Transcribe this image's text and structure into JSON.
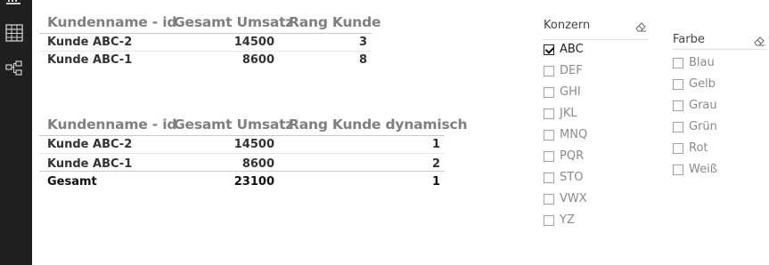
{
  "table1": {
    "headers": [
      "Kundenname - id",
      "Gesamt Umsatz",
      "Rang Kunde"
    ],
    "rows": [
      {
        "name": "Kunde ABC-2",
        "umsatz": "14500",
        "rang": "3"
      },
      {
        "name": "Kunde ABC-1",
        "umsatz": "8600",
        "rang": "8"
      }
    ]
  },
  "table2": {
    "headers": [
      "Kundenname - id",
      "Gesamt Umsatz",
      "Rang Kunde dynamisch"
    ],
    "rows": [
      {
        "name": "Kunde ABC-2",
        "umsatz": "14500",
        "rang": "1"
      },
      {
        "name": "Kunde ABC-1",
        "umsatz": "8600",
        "rang": "2"
      }
    ],
    "total": {
      "name": "Gesamt",
      "umsatz": "23100",
      "rang": "1"
    }
  },
  "slicer_konzern": {
    "title": "Konzern",
    "items": [
      {
        "label": "ABC",
        "checked": true
      },
      {
        "label": "DEF",
        "checked": false
      },
      {
        "label": "GHI",
        "checked": false
      },
      {
        "label": "JKL",
        "checked": false
      },
      {
        "label": "MNQ",
        "checked": false
      },
      {
        "label": "PQR",
        "checked": false
      },
      {
        "label": "STO",
        "checked": false
      },
      {
        "label": "VWX",
        "checked": false
      },
      {
        "label": "YZ",
        "checked": false
      }
    ]
  },
  "slicer_farbe": {
    "title": "Farbe",
    "items": [
      {
        "label": "Blau",
        "checked": false
      },
      {
        "label": "Gelb",
        "checked": false
      },
      {
        "label": "Grau",
        "checked": false
      },
      {
        "label": "Grün",
        "checked": false
      },
      {
        "label": "Rot",
        "checked": false
      },
      {
        "label": "Weiß",
        "checked": false
      }
    ]
  },
  "icons": {
    "left_top": "report-view-icon",
    "data_view": "table-grid-icon",
    "model_view": "relationship-model-icon",
    "clear_filter": "eraser-icon"
  }
}
